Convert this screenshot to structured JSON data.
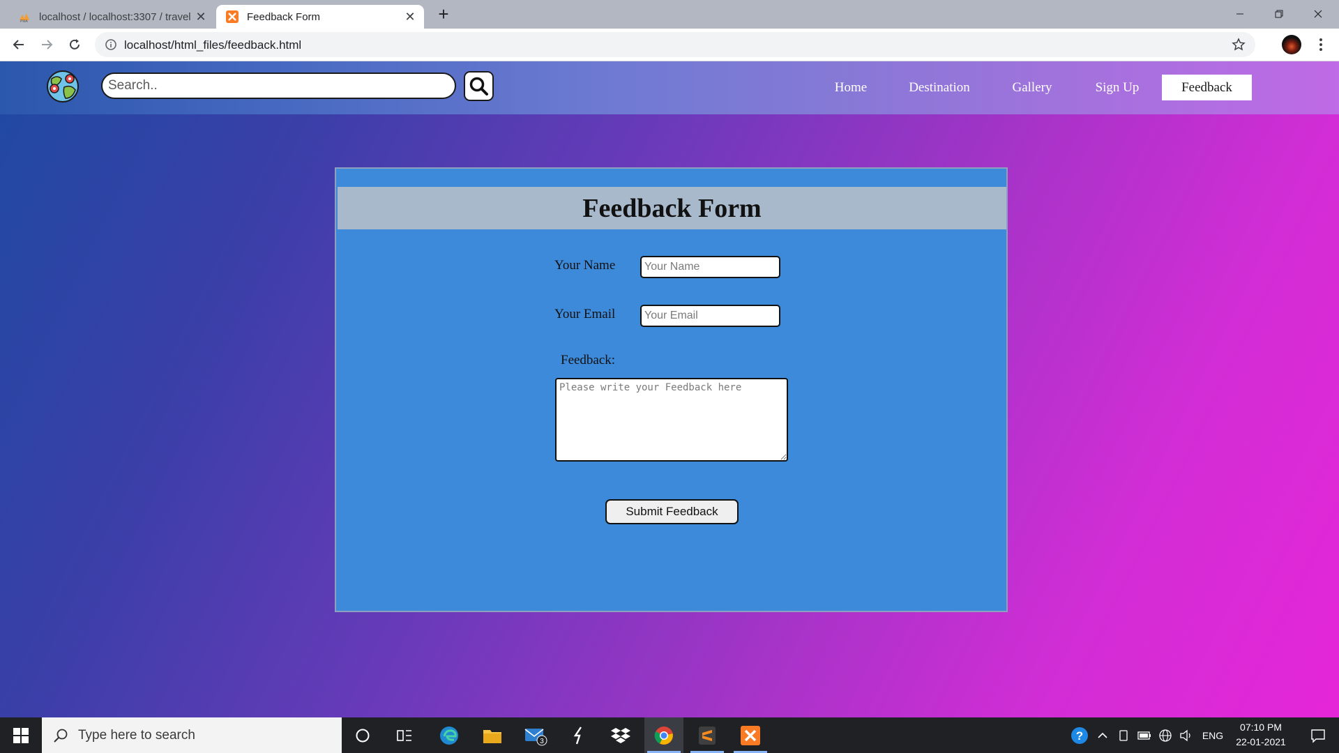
{
  "browser": {
    "tabs": [
      {
        "title": "localhost / localhost:3307 / travel",
        "active": false,
        "close": "✕"
      },
      {
        "title": "Feedback Form",
        "active": true,
        "close": "✕"
      }
    ],
    "new_tab": "+",
    "url": "localhost/html_files/feedback.html"
  },
  "site": {
    "search_placeholder": "Search..",
    "nav": {
      "home": "Home",
      "destination": "Destination",
      "gallery": "Gallery",
      "signup": "Sign Up",
      "feedback": "Feedback"
    },
    "active_nav": "Feedback"
  },
  "form": {
    "title": "Feedback Form",
    "name_label": "Your Name",
    "name_placeholder": "Your Name",
    "email_label": "Your Email",
    "email_placeholder": "Your Email",
    "feedback_label": "Feedback:",
    "feedback_placeholder": "Please write your Feedback here",
    "submit_label": "Submit Feedback"
  },
  "taskbar": {
    "search_text": "Type here to search",
    "mail_badge": "3",
    "language": "ENG",
    "time": "07:10 PM",
    "date": "22-01-2021"
  },
  "colors": {
    "nav_gradient_start": "#2b57ad",
    "nav_gradient_end": "#bf6ae6",
    "card_bg": "#3d8ada",
    "header_bg": "#a9b9cc",
    "page_gradient_start": "#1f4aa2",
    "page_gradient_end": "#e526d8"
  }
}
